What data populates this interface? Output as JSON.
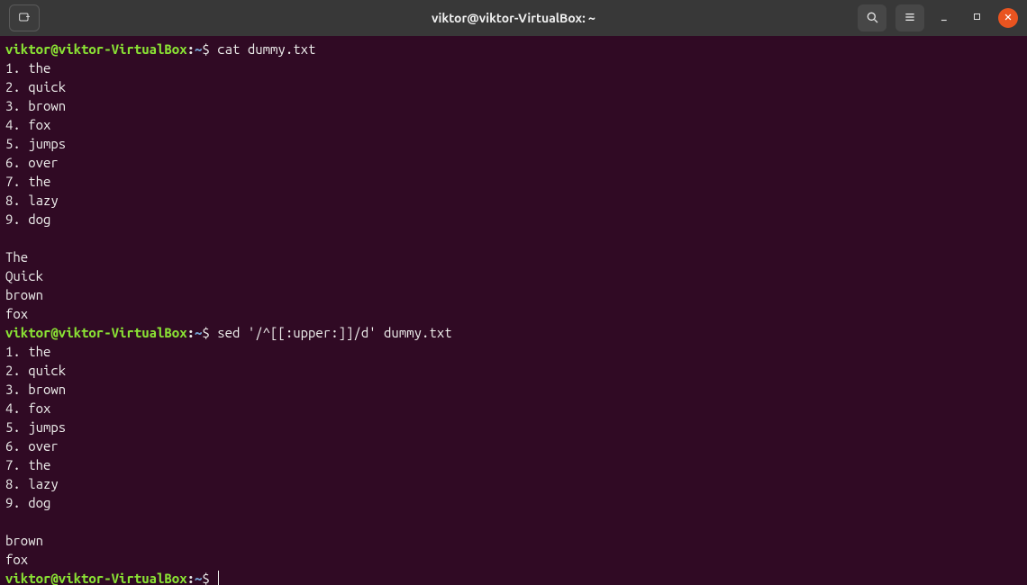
{
  "titlebar": {
    "title": "viktor@viktor-VirtualBox: ~",
    "new_tab_icon": "new-tab-icon",
    "search_icon": "search-icon",
    "menu_icon": "hamburger-icon",
    "minimize_icon": "minimize-icon",
    "maximize_icon": "maximize-icon",
    "close_icon": "close-icon"
  },
  "prompt": {
    "user_host": "viktor@viktor-VirtualBox",
    "separator": ":",
    "path": "~",
    "symbol": "$"
  },
  "session": {
    "entries": [
      {
        "command": "cat dummy.txt",
        "output": [
          "1. the",
          "2. quick",
          "3. brown",
          "4. fox",
          "5. jumps",
          "6. over",
          "7. the",
          "8. lazy",
          "9. dog",
          "",
          "The",
          "Quick",
          "brown",
          "fox"
        ]
      },
      {
        "command": "sed '/^[[:upper:]]/d' dummy.txt",
        "output": [
          "1. the",
          "2. quick",
          "3. brown",
          "4. fox",
          "5. jumps",
          "6. over",
          "7. the",
          "8. lazy",
          "9. dog",
          "",
          "brown",
          "fox"
        ]
      }
    ],
    "trailing_prompt": true
  },
  "colors": {
    "term_bg": "#300a24",
    "fg": "#eeeeec",
    "prompt_user": "#8ae234",
    "prompt_path": "#729fcf",
    "close_btn": "#e95420"
  }
}
